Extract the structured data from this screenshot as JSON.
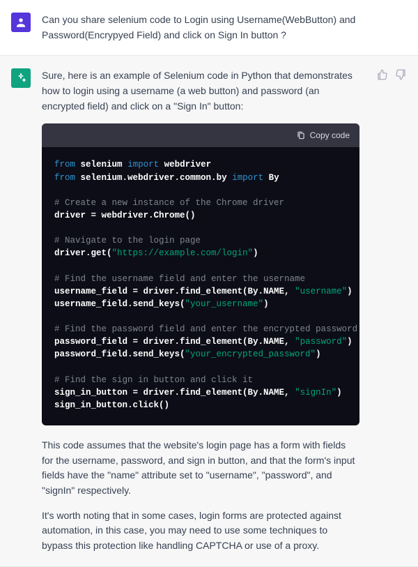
{
  "user": {
    "message": "Can you share selenium code to Login using Username(WebButton) and Password(Encrypyed Field) and click on Sign In button ?"
  },
  "assistant": {
    "intro": "Sure, here is an example of Selenium code in Python that demonstrates how to login using a username (a web button) and password (an encrypted field) and click on a \"Sign In\" button:",
    "copy_label": "Copy code",
    "para2": "This code assumes that the website's login page has a form with fields for the username, password, and sign in button, and that the form's input fields have the \"name\" attribute set to \"username\", \"password\", and \"signIn\" respectively.",
    "para3": "It's worth noting that in some cases, login forms are protected against automation, in this case, you may need to use some techniques to bypass this protection like handling CAPTCHA or use of a proxy."
  },
  "code": {
    "kw_from": "from",
    "kw_import": "import",
    "pkg_selenium": "selenium",
    "pkg_webdriver": "webdriver",
    "pkg_by_path": "selenium.webdriver.common.by",
    "pkg_by": "By",
    "cmt_driver": "# Create a new instance of the Chrome driver",
    "line_driver": "driver = webdriver.Chrome()",
    "cmt_nav": "# Navigate to the login page",
    "nav_prefix": "driver.get(",
    "nav_url": "\"https://example.com/login\"",
    "nav_suffix": ")",
    "cmt_user": "# Find the username field and enter the username",
    "uf_prefix": "username_field = driver.find_element(By.NAME, ",
    "uf_str": "\"username\"",
    "uf_suffix": ")",
    "uk_prefix": "username_field.send_keys(",
    "uk_str": "\"your_username\"",
    "uk_suffix": ")",
    "cmt_pass": "# Find the password field and enter the encrypted password",
    "pf_prefix": "password_field = driver.find_element(By.NAME, ",
    "pf_str": "\"password\"",
    "pf_suffix": ")",
    "pk_prefix": "password_field.send_keys(",
    "pk_str": "\"your_encrypted_password\"",
    "pk_suffix": ")",
    "cmt_sign": "# Find the sign in button and click it",
    "sb_prefix": "sign_in_button = driver.find_element(By.NAME, ",
    "sb_str": "\"signIn\"",
    "sb_suffix": ")",
    "sb_click": "sign_in_button.click()"
  }
}
